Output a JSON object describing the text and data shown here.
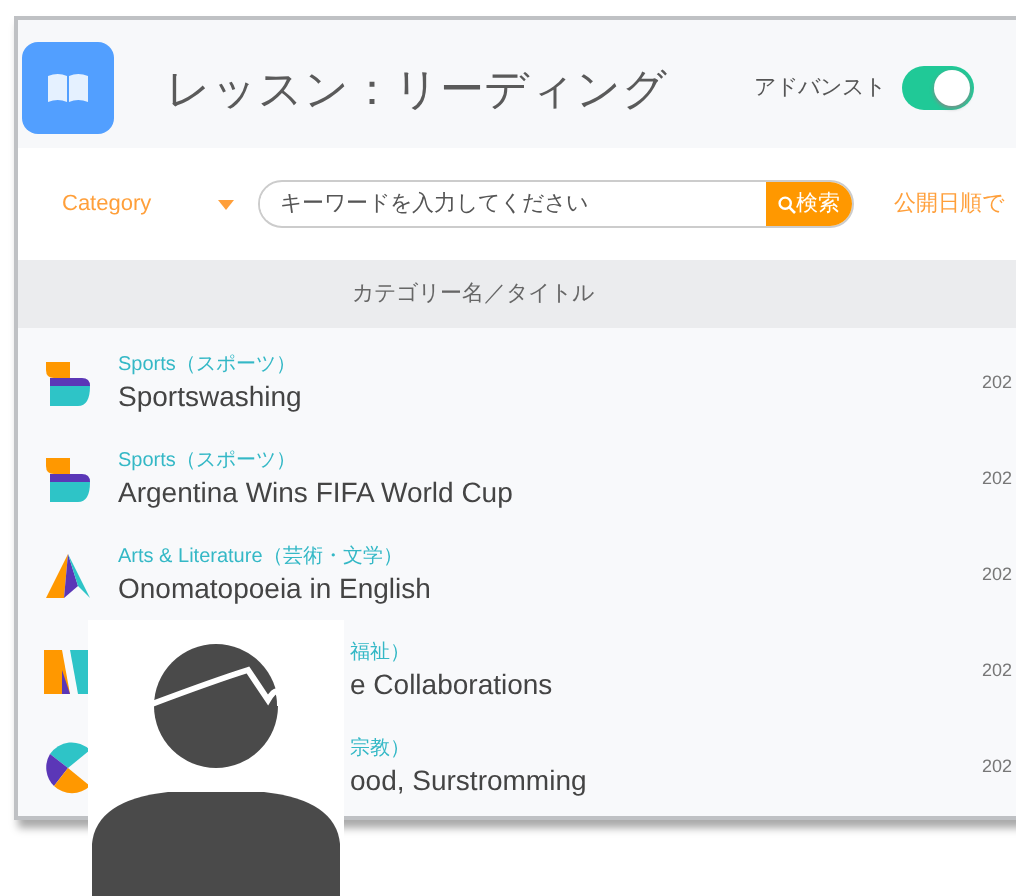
{
  "header": {
    "title": "レッスン：リーディング",
    "advanced": {
      "label": "アドバンスト",
      "on": true
    }
  },
  "toolbar": {
    "category": "Category",
    "search": {
      "placeholder": "キーワードを入力してください",
      "button": "検索"
    },
    "sort": "公開日順で"
  },
  "table": {
    "columns": [
      "カテゴリー名／タイトル"
    ],
    "rows": [
      {
        "kind": "sports",
        "category": "Sports（スポーツ）",
        "title": "Sportswashing",
        "date": "202"
      },
      {
        "kind": "sports",
        "category": "Sports（スポーツ）",
        "title": "Argentina Wins FIFA World Cup",
        "date": "202"
      },
      {
        "kind": "arts",
        "category": "Arts & Literature（芸術・文学）",
        "title": "Onomatopoeia in English",
        "date": "202"
      },
      {
        "kind": "welfare",
        "category": "福祉）",
        "title": "e Collaborations",
        "date": "202"
      },
      {
        "kind": "religion",
        "category": "宗教）",
        "title": "ood, Surstromming",
        "date": "202"
      }
    ]
  }
}
